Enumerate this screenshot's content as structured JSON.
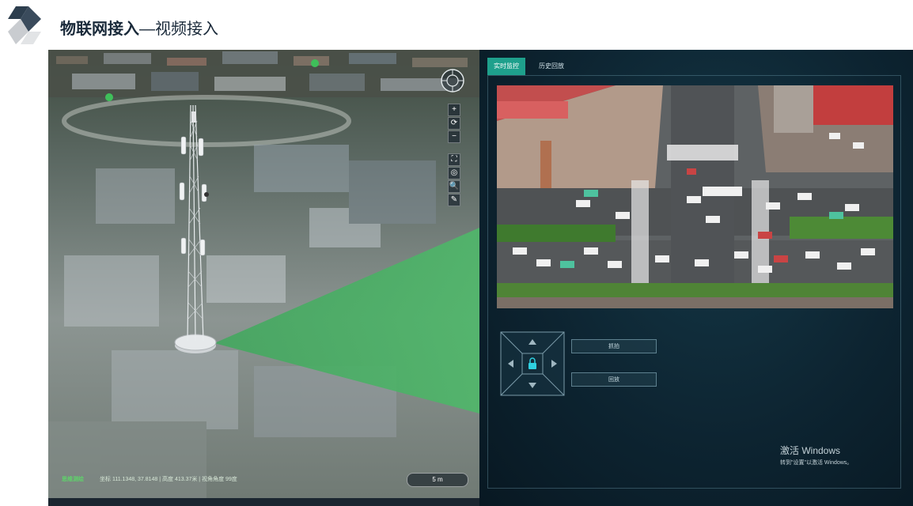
{
  "header": {
    "title_main": "物联网接入",
    "title_sub": "—视频接入"
  },
  "map": {
    "status_brand": "思维测绘",
    "status_text": "坐标 111.1348, 37.8148 | 高度 413.37米 | 视角角度 99度",
    "scale_label": "5 m",
    "tools": [
      "+",
      "⟳",
      "−",
      "⛶",
      "◎",
      "🔍",
      "✎"
    ]
  },
  "panel": {
    "tabs": [
      {
        "label": "实时监控",
        "active": true
      },
      {
        "label": "历史回放",
        "active": false
      }
    ],
    "buttons": {
      "capture": "抓拍",
      "playback": "回放"
    }
  },
  "activation": {
    "line1": "激活 Windows",
    "line2": "转到\"设置\"以激活 Windows。"
  }
}
